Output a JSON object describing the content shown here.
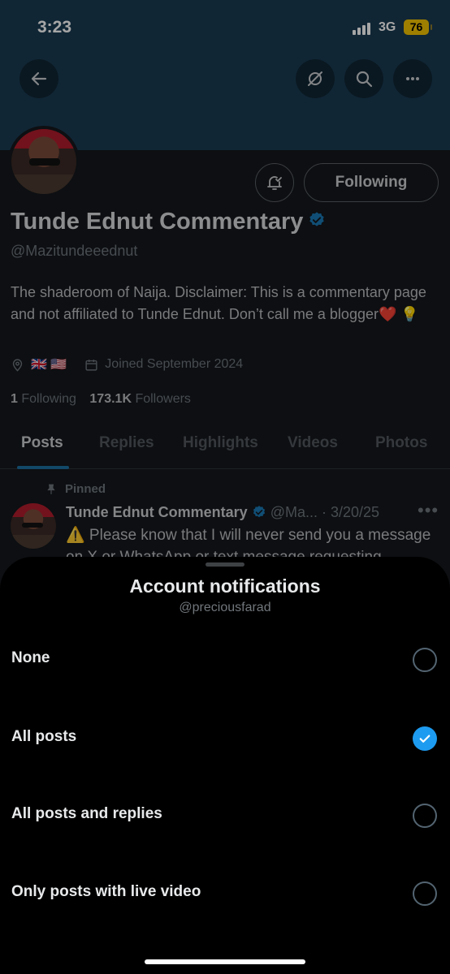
{
  "status_bar": {
    "time": "3:23",
    "network": "3G",
    "battery": "76"
  },
  "profile": {
    "display_name": "Tunde Ednut Commentary",
    "handle": "@Mazitundeeednut",
    "bio": "The shaderoom of Naija. Disclaimer: This is a commentary page and not affiliated to Tunde Ednut. Don’t call me a blogger❤️ 💡",
    "location": "🇬🇧 🇺🇸",
    "joined": "Joined September 2024",
    "following_count": "1",
    "following_label": "Following",
    "followers_count": "173.1K",
    "followers_label": "Followers",
    "following_button": "Following"
  },
  "tabs": [
    {
      "label": "Posts"
    },
    {
      "label": "Replies"
    },
    {
      "label": "Highlights"
    },
    {
      "label": "Videos"
    },
    {
      "label": "Photos"
    }
  ],
  "pinned_post": {
    "pinned_label": "Pinned",
    "author": "Tunde Ednut Commentary",
    "handle_date": "@Ma... · 3/20/25",
    "text": "⚠️ Please know that I will never send you a message on X or WhatsApp or text message requesting"
  },
  "sheet": {
    "title": "Account notifications",
    "subtitle": "@preciousfarad",
    "options": [
      {
        "label": "None",
        "selected": false
      },
      {
        "label": "All posts",
        "selected": true
      },
      {
        "label": "All posts and replies",
        "selected": false
      },
      {
        "label": "Only posts with live video",
        "selected": false
      }
    ]
  },
  "colors": {
    "accent": "#1d9bf0",
    "banner": "#1a3b52",
    "battery": "#f5c400"
  }
}
